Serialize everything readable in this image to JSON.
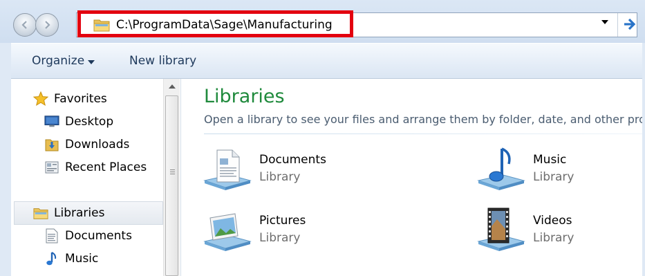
{
  "address_bar": {
    "path": "C:\\ProgramData\\Sage\\Manufacturing"
  },
  "toolbar": {
    "organize_label": "Organize",
    "new_library_label": "New library"
  },
  "nav": {
    "favorites": {
      "label": "Favorites",
      "items": [
        {
          "label": "Desktop",
          "icon": "desktop-icon"
        },
        {
          "label": "Downloads",
          "icon": "downloads-folder-icon"
        },
        {
          "label": "Recent Places",
          "icon": "recent-places-icon"
        }
      ]
    },
    "libraries": {
      "label": "Libraries",
      "items": [
        {
          "label": "Documents",
          "icon": "documents-icon"
        },
        {
          "label": "Music",
          "icon": "music-icon"
        }
      ]
    }
  },
  "content": {
    "title": "Libraries",
    "subtitle": "Open a library to see your files and arrange them by folder, date, and other pro",
    "libraries": [
      {
        "name": "Documents",
        "type": "Library",
        "icon": "documents-library-icon"
      },
      {
        "name": "Music",
        "type": "Library",
        "icon": "music-library-icon"
      },
      {
        "name": "Pictures",
        "type": "Library",
        "icon": "pictures-library-icon"
      },
      {
        "name": "Videos",
        "type": "Library",
        "icon": "videos-library-icon"
      }
    ]
  },
  "colors": {
    "accent_title": "#1f8a3c",
    "highlight_border": "#e3000f",
    "toolbar_text": "#1e395b"
  }
}
